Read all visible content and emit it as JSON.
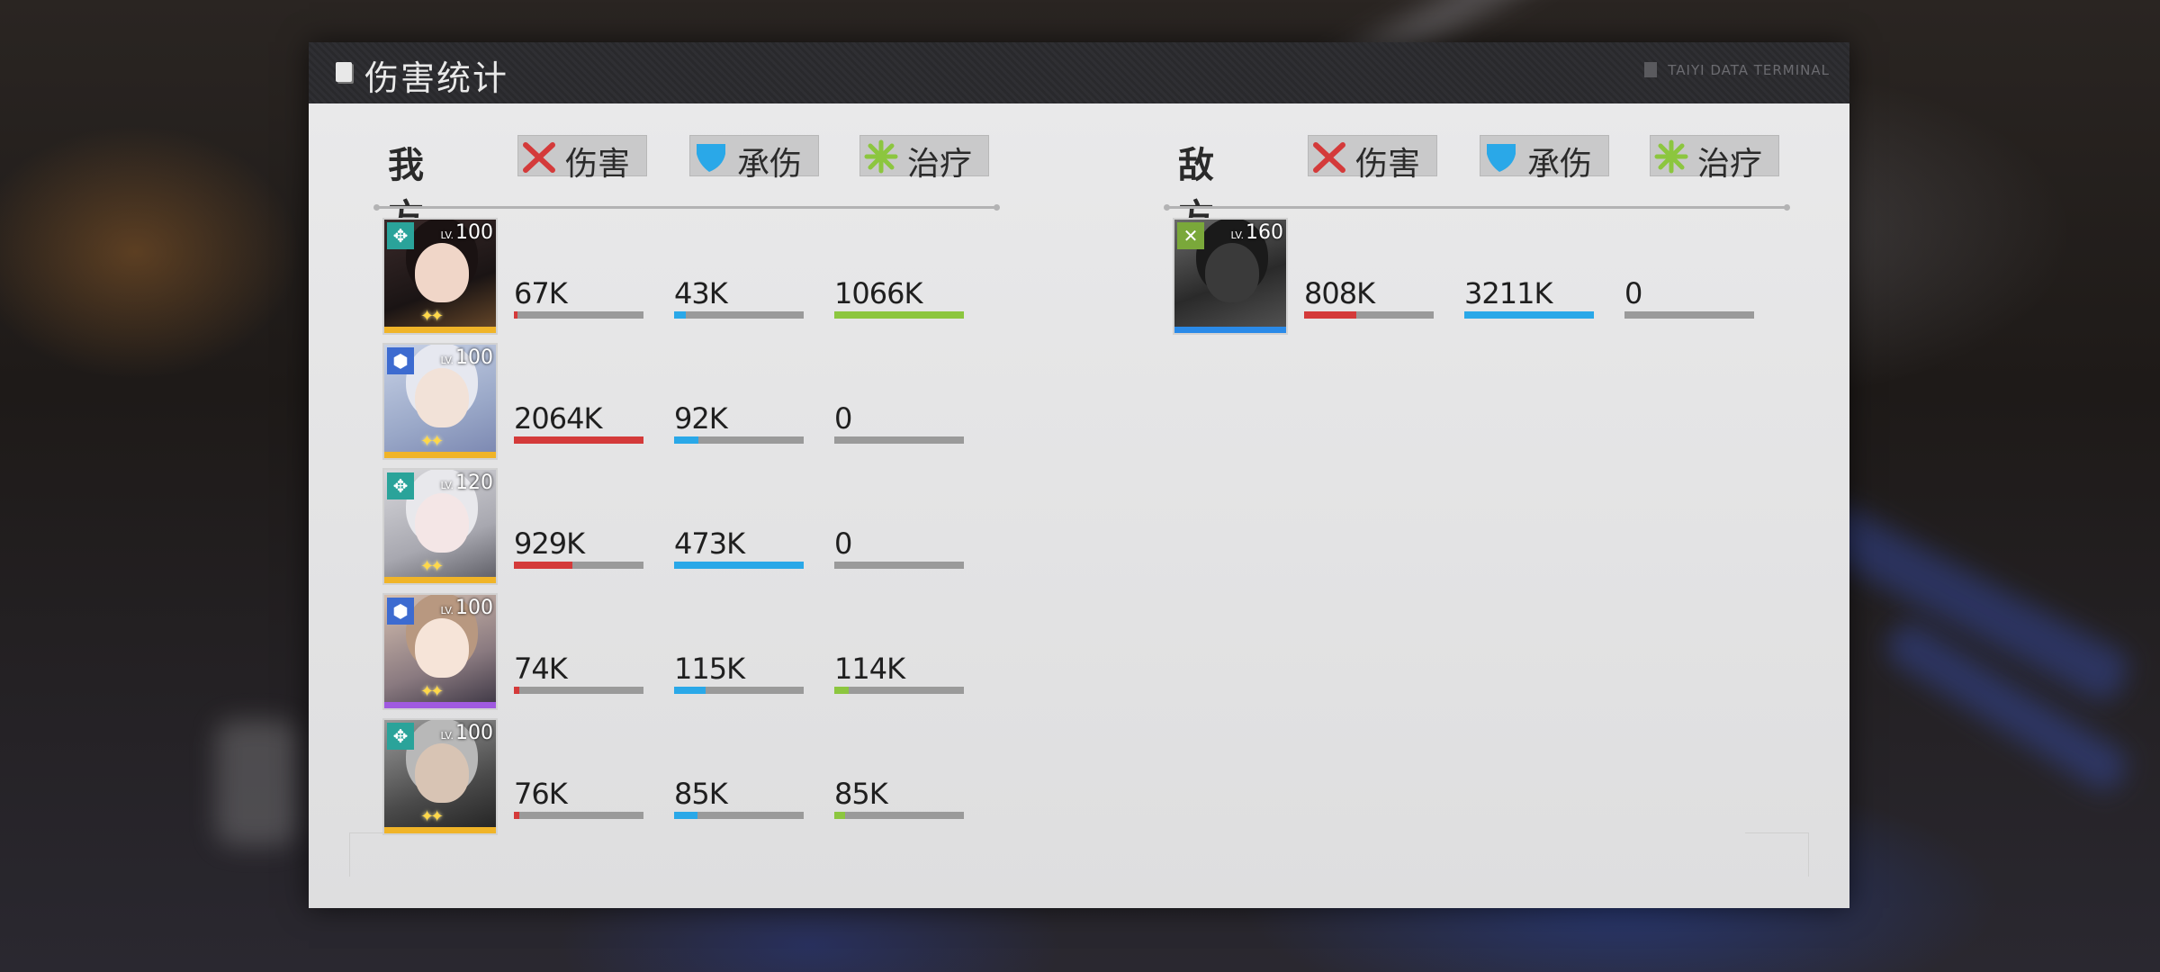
{
  "header": {
    "title": "伤害统计",
    "right_text": "TAIYI DATA TERMINAL"
  },
  "colors": {
    "damage": "#d43a3a",
    "taken": "#2aa8e8",
    "heal": "#8cc63f"
  },
  "ally": {
    "title": "我方",
    "tabs": [
      {
        "icon": "crossed-swords-icon",
        "label": "伤害"
      },
      {
        "icon": "shield-icon",
        "label": "承伤"
      },
      {
        "icon": "heal-burst-icon",
        "label": "治疗"
      }
    ],
    "members": [
      {
        "level_prefix": "LV.",
        "level": "100",
        "class_icon": "support-class-icon",
        "damage": "67K",
        "damage_pct": 0.03,
        "taken": "43K",
        "taken_pct": 0.09,
        "heal": "1066K",
        "heal_pct": 1.0
      },
      {
        "level_prefix": "LV.",
        "level": "100",
        "class_icon": "defender-class-icon",
        "damage": "2064K",
        "damage_pct": 1.0,
        "taken": "92K",
        "taken_pct": 0.19,
        "heal": "0",
        "heal_pct": 0
      },
      {
        "level_prefix": "LV.",
        "level": "120",
        "class_icon": "support-class-icon",
        "damage": "929K",
        "damage_pct": 0.45,
        "taken": "473K",
        "taken_pct": 1.0,
        "heal": "0",
        "heal_pct": 0
      },
      {
        "level_prefix": "LV.",
        "level": "100",
        "class_icon": "defender-class-icon",
        "damage": "74K",
        "damage_pct": 0.04,
        "taken": "115K",
        "taken_pct": 0.24,
        "heal": "114K",
        "heal_pct": 0.11
      },
      {
        "level_prefix": "LV.",
        "level": "100",
        "class_icon": "support-class-icon",
        "damage": "76K",
        "damage_pct": 0.04,
        "taken": "85K",
        "taken_pct": 0.18,
        "heal": "85K",
        "heal_pct": 0.08
      }
    ]
  },
  "enemy": {
    "title": "敌方",
    "tabs": [
      {
        "icon": "crossed-swords-icon",
        "label": "伤害"
      },
      {
        "icon": "shield-icon",
        "label": "承伤"
      },
      {
        "icon": "heal-burst-icon",
        "label": "治疗"
      }
    ],
    "members": [
      {
        "level_prefix": "LV.",
        "level": "160",
        "class_icon": "boss-class-icon",
        "damage": "808K",
        "damage_pct": 0.4,
        "taken": "3211K",
        "taken_pct": 1.0,
        "heal": "0",
        "heal_pct": 0
      }
    ]
  }
}
